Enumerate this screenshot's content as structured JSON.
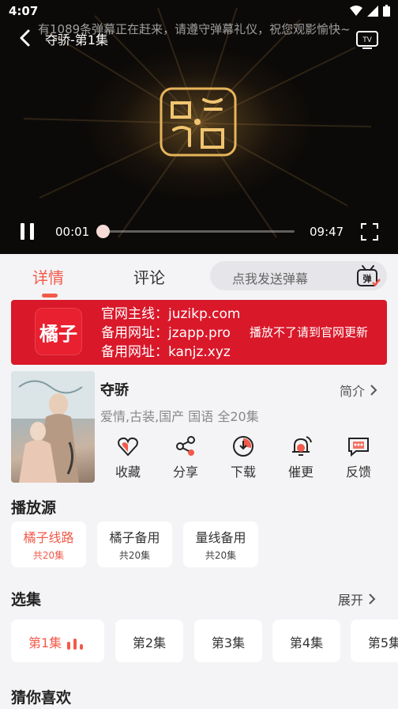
{
  "status_bar": {
    "time": "4:07"
  },
  "player": {
    "title": "夺骄-第1集",
    "danmu_notice": "有1089条弹幕正在赶来，请遵守弹幕礼仪，祝您观影愉快~",
    "current_time": "00:01",
    "total_time": "09:47",
    "progress_fraction": 0.002,
    "accent_color": "#f46b5a"
  },
  "tabs": {
    "details": "详情",
    "comments": "评论",
    "danmu_placeholder": "点我发送弹幕"
  },
  "banner": {
    "logo_text": "橘子",
    "line1": "官网主线：juzikp.com",
    "line2": "备用网址：jzapp.pro",
    "line3": "备用网址：kanjz.xyz",
    "note": "播放不了请到官网更新",
    "background": "#d9182a"
  },
  "show": {
    "title": "夺骄",
    "intro_label": "简介",
    "meta": "爱情,古装,国产 国语 全20集",
    "actions": [
      {
        "label": "收藏",
        "icon": "heart-icon"
      },
      {
        "label": "分享",
        "icon": "share-icon"
      },
      {
        "label": "下载",
        "icon": "download-icon"
      },
      {
        "label": "催更",
        "icon": "bell-icon"
      },
      {
        "label": "反馈",
        "icon": "feedback-icon"
      }
    ]
  },
  "sources": {
    "title": "播放源",
    "items": [
      {
        "name": "橘子线路",
        "count": "共20集",
        "active": true
      },
      {
        "name": "橘子备用",
        "count": "共20集",
        "active": false
      },
      {
        "name": "量线备用",
        "count": "共20集",
        "active": false
      }
    ]
  },
  "episodes": {
    "title": "选集",
    "expand_label": "展开",
    "items": [
      "第1集",
      "第2集",
      "第3集",
      "第4集",
      "第5集"
    ]
  },
  "recommend": {
    "title": "猜你喜欢"
  }
}
